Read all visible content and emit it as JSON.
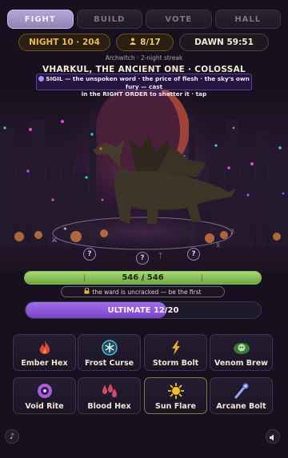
{
  "tabs": [
    {
      "label": "FIGHT",
      "active": true
    },
    {
      "label": "BUILD",
      "active": false
    },
    {
      "label": "VOTE",
      "active": false
    },
    {
      "label": "HALL",
      "active": false
    }
  ],
  "status": {
    "night": "NIGHT 10 · 204",
    "party": "8/17",
    "party_icon": "crowd-icon",
    "dawn": "DAWN 59:51"
  },
  "subtitle": "Archwitch · 2-night streak",
  "boss": {
    "name": "VHARKUL, THE ANCIENT ONE · COLOSSAL",
    "riddle_line1": "SIGIL — the unspoken word · the price of flesh · the sky's own fury — cast",
    "riddle_line2": "in the RIGHT ORDER to shatter it · tap"
  },
  "runes": [
    "?",
    "?",
    "?"
  ],
  "hp": {
    "text": "546 / 546",
    "current": 546,
    "max": 546
  },
  "ward": {
    "text": "the ward is uncracked — be the first",
    "icon": "lock-icon"
  },
  "ultimate": {
    "text": "ULTIMATE 12/20",
    "current": 12,
    "max": 20
  },
  "spells": [
    {
      "label": "Ember Hex",
      "icon": "flame-icon",
      "color": "#d94a3a"
    },
    {
      "label": "Frost Curse",
      "icon": "snowflake-icon",
      "color": "#56b8d6"
    },
    {
      "label": "Storm Bolt",
      "icon": "lightning-icon",
      "color": "#e8a93a"
    },
    {
      "label": "Venom Brew",
      "icon": "skull-cloud-icon",
      "color": "#5fb54a"
    },
    {
      "label": "Void Rite",
      "icon": "void-eye-icon",
      "color": "#a55fd9"
    },
    {
      "label": "Blood Hex",
      "icon": "blood-drops-icon",
      "color": "#d94a6a"
    },
    {
      "label": "Sun Flare",
      "icon": "sun-icon",
      "color": "#f0c22a"
    },
    {
      "label": "Arcane Bolt",
      "icon": "wand-icon",
      "color": "#6f7fe0"
    }
  ],
  "controls": {
    "music_icon": "music-note-icon",
    "sound_icon": "speaker-icon"
  },
  "colors": {
    "accent": "#8f84b4",
    "gold": "#e8b85a",
    "hp": "#8bc35a",
    "ultimate": "#8b55dc"
  }
}
